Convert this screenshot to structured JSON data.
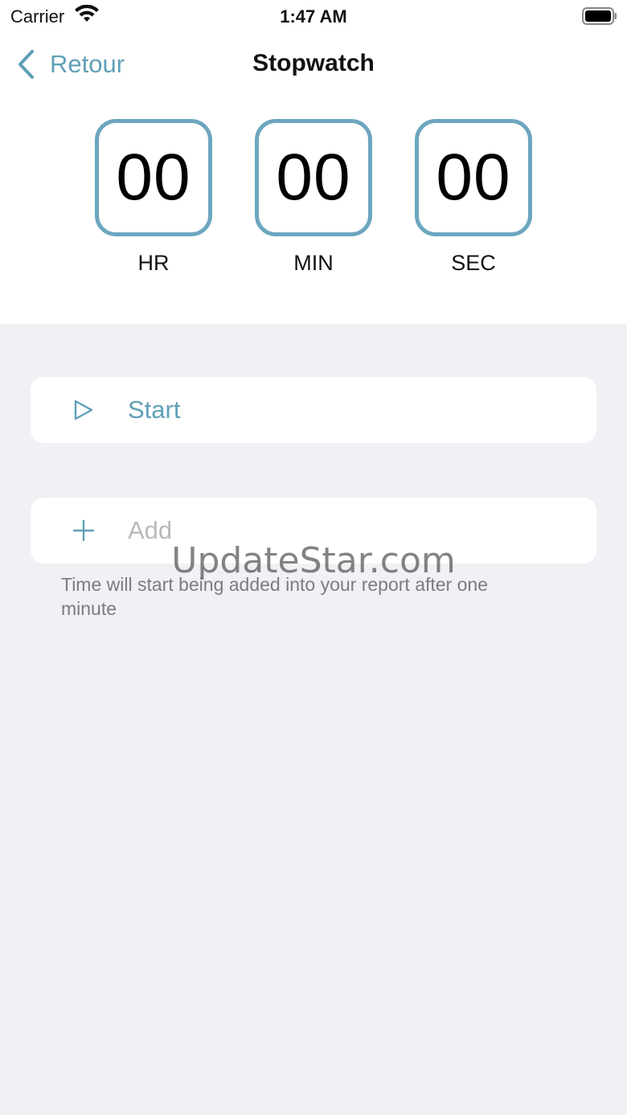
{
  "status_bar": {
    "carrier": "Carrier",
    "time": "1:47 AM"
  },
  "nav": {
    "back_label": "Retour",
    "title": "Stopwatch"
  },
  "timer": {
    "hours": "00",
    "minutes": "00",
    "seconds": "00",
    "hours_label": "HR",
    "minutes_label": "MIN",
    "seconds_label": "SEC"
  },
  "actions": {
    "start_label": "Start",
    "start_icon": "play-icon",
    "add_placeholder": "Add",
    "add_icon": "plus-icon"
  },
  "hint": "Time will start being added into your report after one minute",
  "watermark": "UpdateStar.com",
  "colors": {
    "accent": "#5f9fb8",
    "timer_border": "#6ca6bf",
    "background": "#f0f0f5"
  }
}
